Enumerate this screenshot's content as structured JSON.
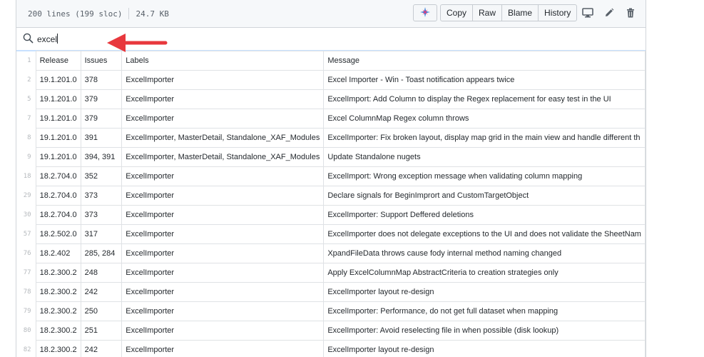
{
  "file_info": {
    "lines": "200 lines (199 sloc)",
    "size": "24.7 KB"
  },
  "toolbar": {
    "copy_label": "Copy",
    "raw_label": "Raw",
    "blame_label": "Blame",
    "history_label": "History",
    "icons": [
      "sparkle-icon",
      "desktop-icon",
      "pencil-icon",
      "trash-icon"
    ]
  },
  "search": {
    "value": "excel"
  },
  "table": {
    "header_line": "1",
    "columns": [
      "Release",
      "Issues",
      "Labels",
      "Message"
    ],
    "rows": [
      {
        "ln": "2",
        "cells": [
          "19.1.201.0",
          "378",
          "ExcelImporter",
          "Excel Importer - Win - Toast notification appears twice"
        ]
      },
      {
        "ln": "5",
        "cells": [
          "19.1.201.0",
          "379",
          "ExcelImporter",
          "ExcelImport: Add Column to display the Regex replacement for easy test in the UI"
        ]
      },
      {
        "ln": "7",
        "cells": [
          "19.1.201.0",
          "379",
          "ExcelImporter",
          "Excel ColumnMap Regex column throws"
        ]
      },
      {
        "ln": "8",
        "cells": [
          "19.1.201.0",
          "391",
          "ExcelImporter, MasterDetail, Standalone_XAF_Modules",
          "ExcelImporter: Fix broken layout, display map grid in the main view and handle different th"
        ]
      },
      {
        "ln": "9",
        "cells": [
          "19.1.201.0",
          "394, 391",
          "ExcelImporter, MasterDetail, Standalone_XAF_Modules",
          "Update Standalone nugets"
        ]
      },
      {
        "ln": "18",
        "cells": [
          "18.2.704.0",
          "352",
          "ExcelImporter",
          "ExcelImport: Wrong exception message when validating column mapping"
        ]
      },
      {
        "ln": "29",
        "cells": [
          "18.2.704.0",
          "373",
          "ExcelImporter",
          "Declare signals for BeginImprort and CustomTargetObject"
        ]
      },
      {
        "ln": "30",
        "cells": [
          "18.2.704.0",
          "373",
          "ExcelImporter",
          "ExcelImporter: Support Deffered deletions"
        ]
      },
      {
        "ln": "57",
        "cells": [
          "18.2.502.0",
          "317",
          "ExcelImporter",
          "ExcelImporter does not delegate exceptions to the UI and does not validate the SheetNam"
        ]
      },
      {
        "ln": "76",
        "cells": [
          "18.2.402",
          "285, 284",
          "ExcelImporter",
          "XpandFileData throws cause fody internal method naming changed"
        ]
      },
      {
        "ln": "77",
        "cells": [
          "18.2.300.2",
          "248",
          "ExcelImporter",
          "Apply ExcelColumnMap AbstractCriteria to creation strategies only"
        ]
      },
      {
        "ln": "78",
        "cells": [
          "18.2.300.2",
          "242",
          "ExcelImporter",
          "ExcelImporter layout re-design"
        ]
      },
      {
        "ln": "79",
        "cells": [
          "18.2.300.2",
          "250",
          "ExcelImporter",
          "ExcelImporter: Performance, do not get full dataset when mapping"
        ]
      },
      {
        "ln": "80",
        "cells": [
          "18.2.300.2",
          "251",
          "ExcelImporter",
          "ExcelImporter: Avoid reselecting file in when possible (disk lookup)"
        ]
      },
      {
        "ln": "82",
        "cells": [
          "18.2.300.2",
          "242",
          "ExcelImporter",
          "ExcelImporter layout re-design"
        ]
      }
    ]
  },
  "annotation": {
    "arrow_color": "#e8383d"
  }
}
